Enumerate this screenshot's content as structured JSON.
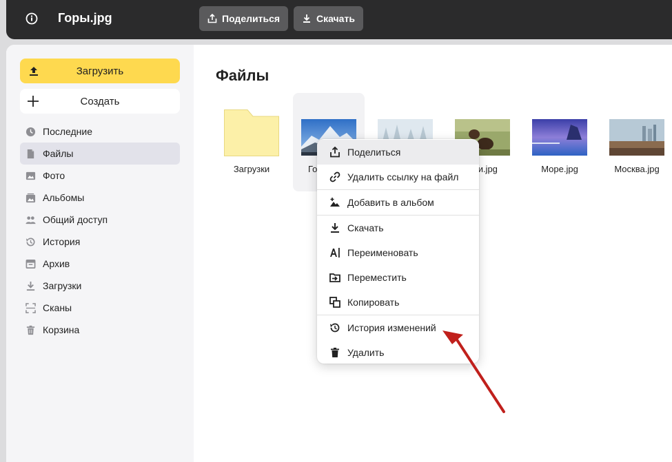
{
  "header": {
    "file_title": "Горы.jpg",
    "share_label": "Поделиться",
    "download_label": "Скачать"
  },
  "sidebar": {
    "upload_label": "Загрузить",
    "create_label": "Создать",
    "items": [
      {
        "label": "Последние",
        "icon": "clock-icon"
      },
      {
        "label": "Файлы",
        "icon": "file-icon",
        "active": true
      },
      {
        "label": "Фото",
        "icon": "photo-icon"
      },
      {
        "label": "Альбомы",
        "icon": "album-icon"
      },
      {
        "label": "Общий доступ",
        "icon": "people-icon"
      },
      {
        "label": "История",
        "icon": "history-icon"
      },
      {
        "label": "Архив",
        "icon": "archive-icon"
      },
      {
        "label": "Загрузки",
        "icon": "download-icon"
      },
      {
        "label": "Сканы",
        "icon": "scan-icon"
      },
      {
        "label": "Корзина",
        "icon": "trash-icon"
      }
    ]
  },
  "main": {
    "title": "Файлы",
    "files": [
      {
        "name": "Загрузки",
        "type": "folder"
      },
      {
        "name": "Го",
        "type": "image"
      },
      {
        "name": "",
        "type": "image"
      },
      {
        "name": "ки.jpg",
        "type": "image"
      },
      {
        "name": "Море.jpg",
        "type": "image"
      },
      {
        "name": "Москва.jpg",
        "type": "image"
      }
    ]
  },
  "context_menu": {
    "items": [
      {
        "label": "Поделиться",
        "icon": "share-icon"
      },
      {
        "label": "Удалить ссылку на файл",
        "icon": "link-icon"
      },
      {
        "label": "Добавить в альбом",
        "icon": "add-album-icon"
      },
      {
        "label": "Скачать",
        "icon": "download-icon"
      },
      {
        "label": "Переименовать",
        "icon": "rename-icon"
      },
      {
        "label": "Переместить",
        "icon": "move-icon"
      },
      {
        "label": "Копировать",
        "icon": "copy-icon"
      },
      {
        "label": "История изменений",
        "icon": "history-icon"
      },
      {
        "label": "Удалить",
        "icon": "trash-icon"
      }
    ]
  },
  "colors": {
    "topbar": "#2b2b2c",
    "upload_button": "#fed94f",
    "annotation_arrow": "#c0201c"
  }
}
